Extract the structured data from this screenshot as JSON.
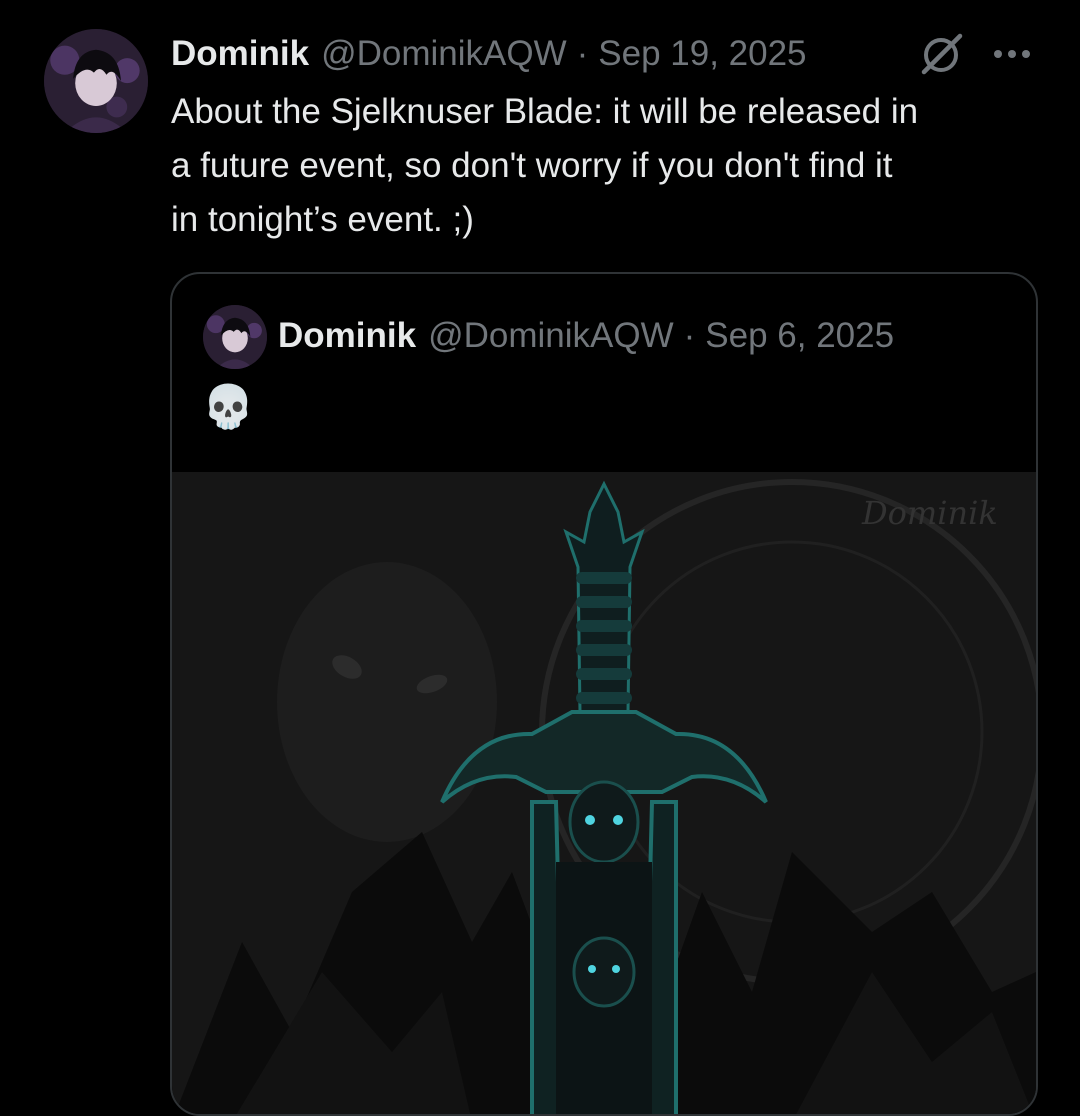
{
  "post": {
    "author_name": "Dominik",
    "handle": "@DominikAQW",
    "separator": "·",
    "date": "Sep 19, 2025",
    "text": "About the Sjelknuser Blade: it will be released in\na future event, so don't worry if you don't find it\nin tonight’s event. ;)",
    "icons": {
      "avatar": "profile-avatar",
      "grok": "grok-slash-icon",
      "more": "more-dots-icon"
    }
  },
  "quoted_post": {
    "author_name": "Dominik",
    "handle": "@DominikAQW",
    "separator": "·",
    "date": "Sep 6, 2025",
    "text": "💀",
    "image": {
      "description_icon": "sword-artwork",
      "watermark": "Dominik"
    }
  },
  "colors": {
    "background": "#000000",
    "text_primary": "#e7e9ea",
    "text_secondary": "#71767b",
    "border": "#2f3336",
    "accent_teal": "#1f6f6c"
  }
}
